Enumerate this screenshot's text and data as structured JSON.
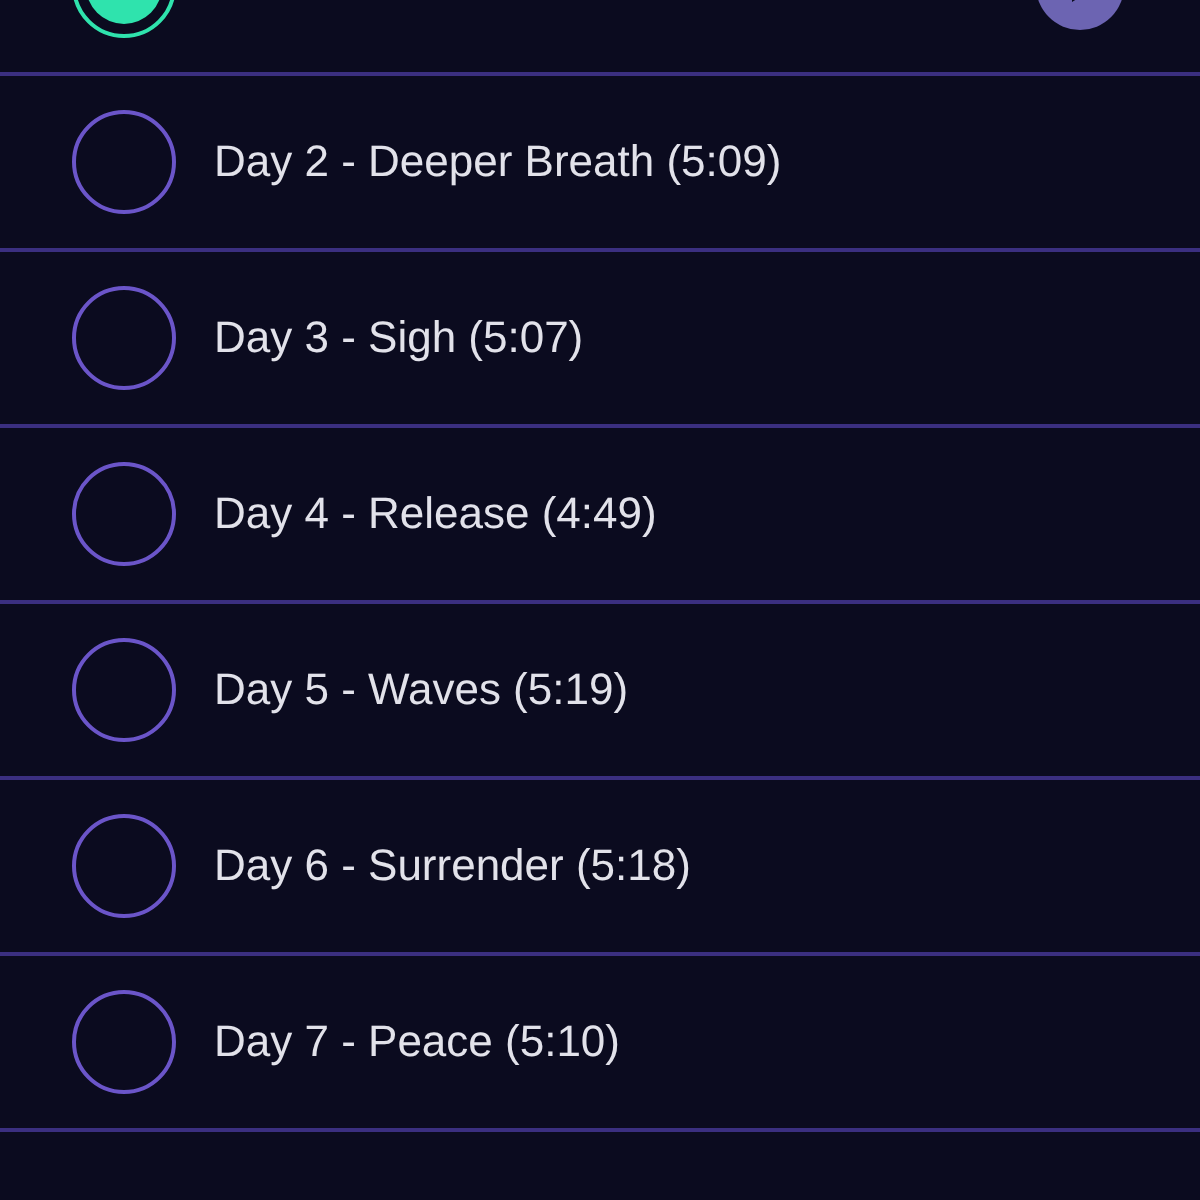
{
  "days": [
    {
      "completed": true,
      "current": true
    },
    {
      "label": "Day 2 - Deeper Breath (5:09)",
      "completed": false,
      "current": false
    },
    {
      "label": "Day 3 - Sigh (5:07)",
      "completed": false,
      "current": false
    },
    {
      "label": "Day 4 - Release (4:49)",
      "completed": false,
      "current": false
    },
    {
      "label": "Day 5 - Waves (5:19)",
      "completed": false,
      "current": false
    },
    {
      "label": "Day 6 - Surrender (5:18)",
      "completed": false,
      "current": false
    },
    {
      "label": "Day 7 - Peace (5:10)",
      "completed": false,
      "current": false
    }
  ]
}
